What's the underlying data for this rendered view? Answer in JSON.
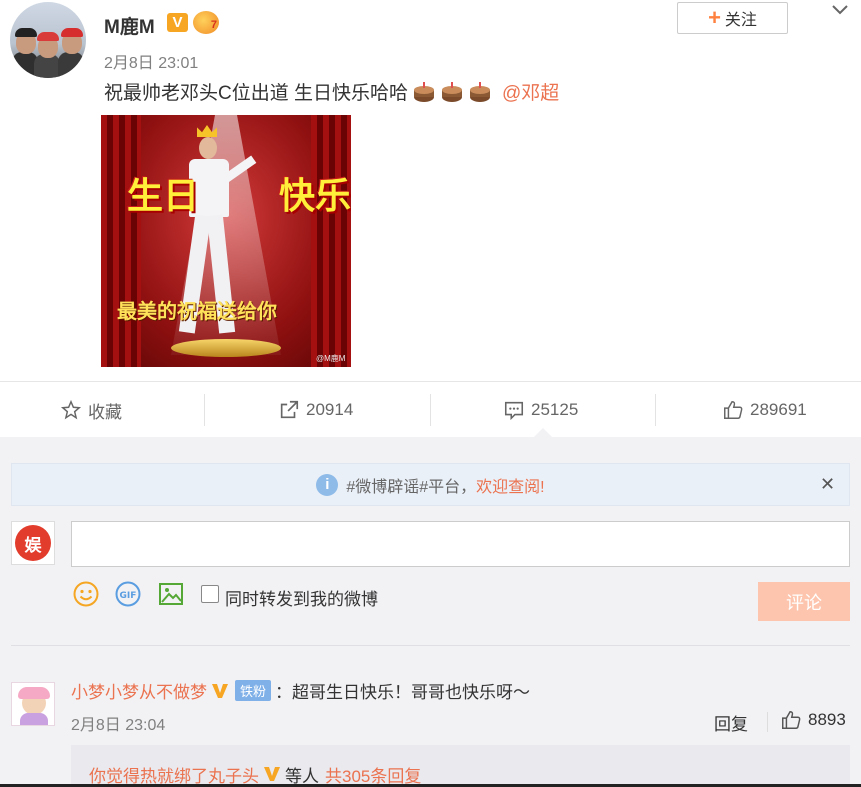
{
  "post": {
    "author": "M鹿M",
    "time": "2月8日 23:01",
    "text": "祝最帅老邓头C位出道 生日快乐哈哈",
    "mention": "@邓超",
    "follow_label": "关注",
    "level_badge": "7",
    "image": {
      "left_chars": "生日",
      "right_chars": "快乐",
      "banner": "最美的祝福送给你",
      "watermark": "@M鹿M"
    }
  },
  "actions": {
    "favorite_label": "收藏",
    "repost_count": "20914",
    "comment_count": "25125",
    "like_count": "289691"
  },
  "notice": {
    "text": "#微博辟谣#平台，",
    "link": "欢迎查阅!"
  },
  "composer": {
    "avatar_text": "娱",
    "placeholder": "",
    "repost_label": "同时转发到我的微博",
    "submit_label": "评论"
  },
  "comments": [
    {
      "name": "小梦小梦从不做梦",
      "fan_badge": "铁粉",
      "text": "：超哥生日快乐！哥哥也快乐呀～",
      "time": "2月8日 23:04",
      "reply_label": "回复",
      "likes": "8893",
      "sub_reply": {
        "name": "你觉得热就绑了丸子头",
        "middle": "等人",
        "total": "共305条回复"
      }
    }
  ],
  "colors": {
    "accent": "#eb7350",
    "vip": "#f6a623",
    "submit_disabled": "#fdc5ad",
    "panel_bg": "#f2f2f5"
  }
}
